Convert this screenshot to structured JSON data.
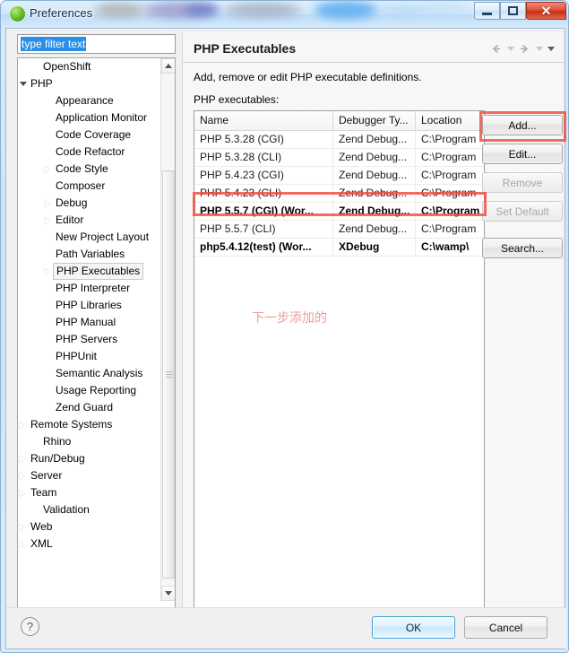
{
  "window": {
    "title": "Preferences",
    "icon": "eclipse-globe-icon",
    "minimize_label": "Minimize",
    "maximize_label": "Maximize",
    "close_label": "✕"
  },
  "filter": {
    "value": "type filter text",
    "placeholder": "type filter text"
  },
  "tree": {
    "items": [
      {
        "label": "OpenShift",
        "indent": 1,
        "arrow": "none",
        "selected": false
      },
      {
        "label": "PHP",
        "indent": 0,
        "arrow": "expanded",
        "selected": false
      },
      {
        "label": "Appearance",
        "indent": 2,
        "arrow": "none",
        "selected": false
      },
      {
        "label": "Application Monitor",
        "indent": 2,
        "arrow": "none",
        "selected": false
      },
      {
        "label": "Code Coverage",
        "indent": 2,
        "arrow": "none",
        "selected": false
      },
      {
        "label": "Code Refactor",
        "indent": 2,
        "arrow": "none",
        "selected": false
      },
      {
        "label": "Code Style",
        "indent": 2,
        "arrow": "collapsed",
        "selected": false
      },
      {
        "label": "Composer",
        "indent": 2,
        "arrow": "none",
        "selected": false
      },
      {
        "label": "Debug",
        "indent": 2,
        "arrow": "collapsed",
        "selected": false
      },
      {
        "label": "Editor",
        "indent": 2,
        "arrow": "collapsed",
        "selected": false
      },
      {
        "label": "New Project Layout",
        "indent": 2,
        "arrow": "none",
        "selected": false
      },
      {
        "label": "Path Variables",
        "indent": 2,
        "arrow": "none",
        "selected": false
      },
      {
        "label": "PHP Executables",
        "indent": 2,
        "arrow": "collapsed",
        "selected": true
      },
      {
        "label": "PHP Interpreter",
        "indent": 2,
        "arrow": "none",
        "selected": false
      },
      {
        "label": "PHP Libraries",
        "indent": 2,
        "arrow": "none",
        "selected": false
      },
      {
        "label": "PHP Manual",
        "indent": 2,
        "arrow": "none",
        "selected": false
      },
      {
        "label": "PHP Servers",
        "indent": 2,
        "arrow": "none",
        "selected": false
      },
      {
        "label": "PHPUnit",
        "indent": 2,
        "arrow": "none",
        "selected": false
      },
      {
        "label": "Semantic Analysis",
        "indent": 2,
        "arrow": "none",
        "selected": false
      },
      {
        "label": "Usage Reporting",
        "indent": 2,
        "arrow": "none",
        "selected": false
      },
      {
        "label": "Zend Guard",
        "indent": 2,
        "arrow": "none",
        "selected": false
      },
      {
        "label": "Remote Systems",
        "indent": 0,
        "arrow": "collapsed",
        "selected": false
      },
      {
        "label": "Rhino",
        "indent": 1,
        "arrow": "none",
        "selected": false
      },
      {
        "label": "Run/Debug",
        "indent": 0,
        "arrow": "collapsed",
        "selected": false
      },
      {
        "label": "Server",
        "indent": 0,
        "arrow": "collapsed",
        "selected": false
      },
      {
        "label": "Team",
        "indent": 0,
        "arrow": "collapsed",
        "selected": false
      },
      {
        "label": "Validation",
        "indent": 1,
        "arrow": "none",
        "selected": false
      },
      {
        "label": "Web",
        "indent": 0,
        "arrow": "collapsed",
        "selected": false
      },
      {
        "label": "XML",
        "indent": 0,
        "arrow": "collapsed",
        "selected": false
      }
    ]
  },
  "content": {
    "title": "PHP Executables",
    "description": "Add, remove or edit PHP executable definitions.",
    "list_label": "PHP executables:",
    "nav": {
      "back": "back-arrow",
      "back_menu": "back-dropdown",
      "forward": "forward-arrow",
      "forward_menu": "forward-dropdown",
      "view_menu": "view-menu-dropdown"
    }
  },
  "table": {
    "columns": [
      "Name",
      "Debugger Ty...",
      "Location"
    ],
    "rows": [
      {
        "name": "PHP 5.3.28 (CGI)",
        "debugger": "Zend Debug...",
        "location": "C:\\Program",
        "bold": false,
        "highlight": false
      },
      {
        "name": "PHP 5.3.28 (CLI)",
        "debugger": "Zend Debug...",
        "location": "C:\\Program",
        "bold": false,
        "highlight": false
      },
      {
        "name": "PHP 5.4.23 (CGI)",
        "debugger": "Zend Debug...",
        "location": "C:\\Program",
        "bold": false,
        "highlight": false
      },
      {
        "name": "PHP 5.4.23 (CLI)",
        "debugger": "Zend Debug...",
        "location": "C:\\Program",
        "bold": false,
        "highlight": false
      },
      {
        "name": "PHP 5.5.7 (CGI) (Wor...",
        "debugger": "Zend Debug...",
        "location": "C:\\Program",
        "bold": true,
        "highlight": false
      },
      {
        "name": "PHP 5.5.7 (CLI)",
        "debugger": "Zend Debug...",
        "location": "C:\\Program",
        "bold": false,
        "highlight": false
      },
      {
        "name": "php5.4.12(test) (Wor...",
        "debugger": "XDebug",
        "location": "C:\\wamp\\",
        "bold": true,
        "highlight": true
      }
    ]
  },
  "buttons": {
    "add": "Add...",
    "edit": "Edit...",
    "remove": "Remove",
    "set_default": "Set Default",
    "search": "Search..."
  },
  "annotation": {
    "text": "下一步添加的",
    "color": "#f09a9a",
    "highlight_color": "#ef4a3d"
  },
  "footer": {
    "help": "?",
    "ok": "OK",
    "cancel": "Cancel"
  }
}
